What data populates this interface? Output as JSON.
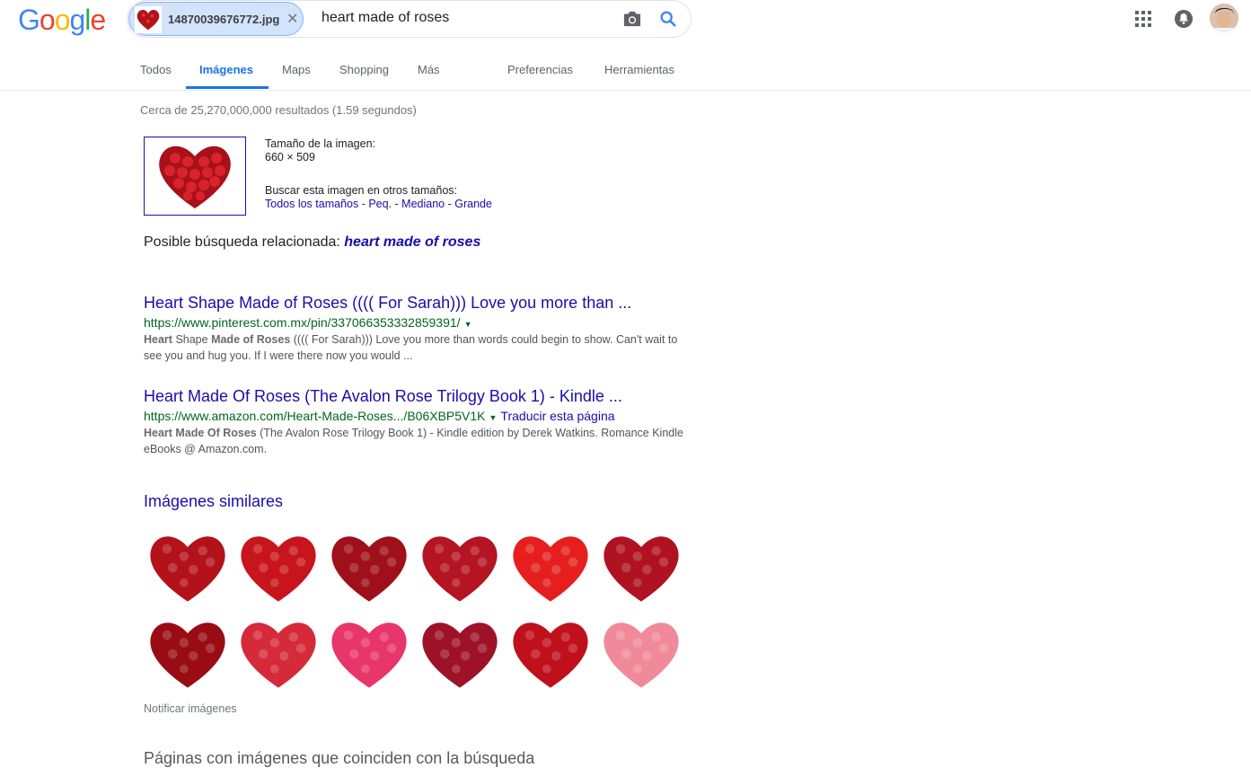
{
  "header": {
    "logo_letters": [
      "G",
      "o",
      "o",
      "g",
      "l",
      "e"
    ],
    "logo_colors": [
      "#4285F4",
      "#EA4335",
      "#FBBC05",
      "#4285F4",
      "#34A853",
      "#EA4335"
    ],
    "image_chip_name": "14870039676772.jpg",
    "query": "heart made of roses"
  },
  "tabs": [
    "Todos",
    "Imágenes",
    "Maps",
    "Shopping",
    "Más",
    "Preferencias",
    "Herramientas"
  ],
  "stats": "Cerca de 25,270,000,000 resultados (1.59 segundos)",
  "image_info": {
    "size_label": "Tamaño de la imagen:",
    "size_value": "660 × 509",
    "other_sizes_label": "Buscar esta imagen en otros tamaños:",
    "sizes": [
      "Todos los tamaños",
      "Peq.",
      "Mediano",
      "Grande"
    ],
    "separator": " - "
  },
  "related": {
    "label": "Posible búsqueda relacionada: ",
    "query": "heart made of roses"
  },
  "results": [
    {
      "title": "Heart Shape Made of Roses (((( For Sarah))) Love you more than ...",
      "url": "https://www.pinterest.com.mx/pin/337066353332859391/",
      "translate": "",
      "snippet_b1": "Heart",
      "snippet_t1": " Shape ",
      "snippet_b2": "Made of Roses",
      "snippet_t2": " (((( For Sarah))) Love you more than words could begin to show. Can't wait to see you and hug you. If I were there now you would ..."
    },
    {
      "title": "Heart Made Of Roses (The Avalon Rose Trilogy Book 1) - Kindle ...",
      "url": "https://www.amazon.com/Heart-Made-Roses.../B06XBP5V1K",
      "translate": "Traducir esta página",
      "snippet_b1": "Heart Made Of Roses",
      "snippet_t1": " (The Avalon Rose Trilogy Book 1) - Kindle edition by Derek Watkins. Romance Kindle eBooks @ Amazon.com.",
      "snippet_b2": "",
      "snippet_t2": ""
    }
  ],
  "similar_title": "Imágenes similares",
  "similar_colors": [
    "#b3121a",
    "#c8141c",
    "#a0101a",
    "#b51423",
    "#e61e1e",
    "#b01222",
    "#9a0c14",
    "#d52a3a",
    "#e8356a",
    "#9e1228",
    "#c0101c",
    "#f08a9a"
  ],
  "notify": "Notificar imágenes",
  "pages_title": "Páginas con imágenes que coinciden con la búsqueda"
}
